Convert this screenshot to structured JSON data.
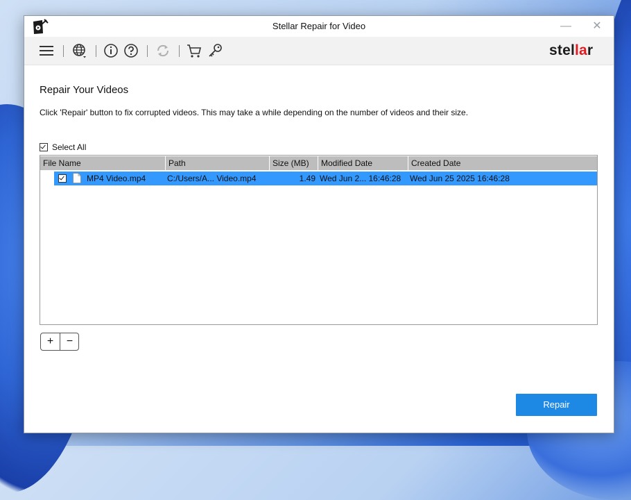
{
  "window": {
    "title": "Stellar Repair for Video"
  },
  "toolbar": {
    "brand_prefix": "stel",
    "brand_accent": "la",
    "brand_suffix": "r",
    "icons": [
      "menu-icon",
      "globe-icon",
      "info-icon",
      "help-icon",
      "refresh-icon",
      "cart-icon",
      "key-icon"
    ]
  },
  "main": {
    "heading": "Repair Your Videos",
    "description": "Click 'Repair' button to fix corrupted videos. This may take a while depending on the number of videos and their size.",
    "select_all_label": "Select All"
  },
  "table": {
    "columns": [
      "File Name",
      "Path",
      "Size (MB)",
      "Modified Date",
      "Created Date"
    ],
    "rows": [
      {
        "file_name": "MP4 Video.mp4",
        "path": "C:/Users/A... Video.mp4",
        "size": "1.49",
        "modified": "Wed Jun 2... 16:46:28",
        "created": "Wed Jun 25 2025 16:46:28",
        "checked": true
      }
    ]
  },
  "buttons": {
    "add": "+",
    "remove": "−",
    "repair": "Repair"
  },
  "colors": {
    "accent": "#1e88e5",
    "selection": "#3399ff",
    "brand_red": "#e21b23"
  }
}
